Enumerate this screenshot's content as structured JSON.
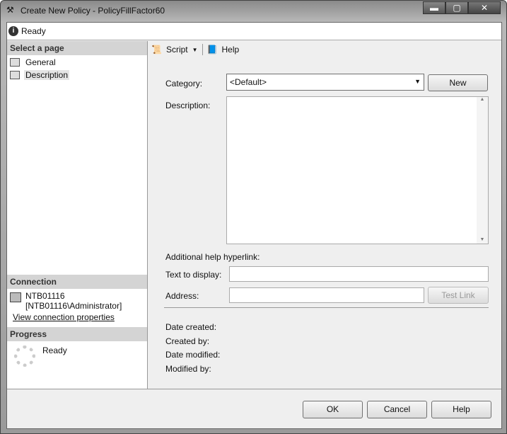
{
  "window": {
    "title": "Create New Policy - PolicyFillFactor60"
  },
  "status": {
    "text": "Ready"
  },
  "left": {
    "select_header": "Select a page",
    "pages": [
      {
        "label": "General"
      },
      {
        "label": "Description"
      }
    ],
    "connection_header": "Connection",
    "server": "NTB01116",
    "user": "[NTB01116\\Administrator]",
    "view_link": "View connection properties",
    "progress_header": "Progress",
    "progress_status": "Ready"
  },
  "toolbar": {
    "script": "Script",
    "help": "Help"
  },
  "form": {
    "category_label": "Category:",
    "category_value": "<Default>",
    "new_button": "New",
    "description_label": "Description:",
    "description_value": "",
    "hyperlink_label": "Additional help hyperlink:",
    "text_display_label": "Text to display:",
    "text_display_value": "",
    "address_label": "Address:",
    "address_value": "",
    "test_link": "Test Link",
    "date_created": "Date created:",
    "created_by": "Created by:",
    "date_modified": "Date modified:",
    "modified_by": "Modified by:"
  },
  "buttons": {
    "ok": "OK",
    "cancel": "Cancel",
    "help": "Help"
  }
}
